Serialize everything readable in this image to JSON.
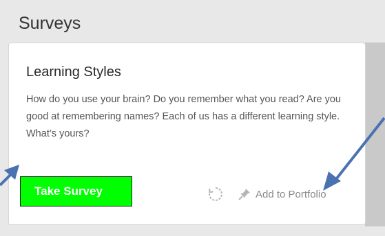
{
  "panel": {
    "title": "Surveys"
  },
  "card": {
    "title": "Learning Styles",
    "description": "How do you use your brain? Do you remember what you read? Are you good at remembering names? Each of us has a different learning style. What’s yours?",
    "take_survey_label": "Take Survey",
    "add_portfolio_label": "Add to Portfolio"
  },
  "icons": {
    "reload": "reload-icon",
    "pin": "pin-icon"
  },
  "colors": {
    "take_survey_bg": "#00ff00",
    "annotation_arrow": "#4a72b0",
    "action_text": "#8a8a8a"
  }
}
